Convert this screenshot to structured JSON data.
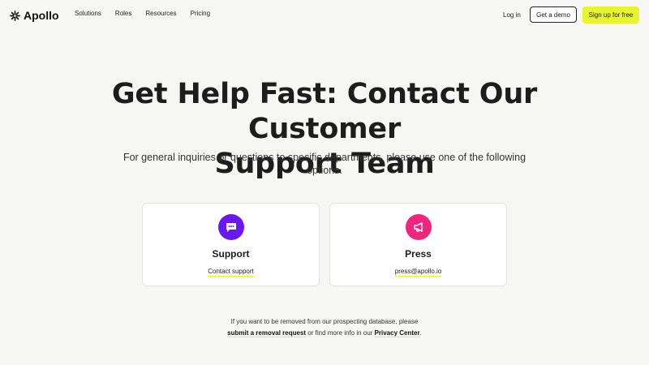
{
  "header": {
    "brand": "Apollo",
    "nav": [
      "Solutions",
      "Roles",
      "Resources",
      "Pricing"
    ],
    "login": "Log in",
    "demo": "Get a demo",
    "signup": "Sign up for free"
  },
  "hero": {
    "title_line1": "Get Help Fast: Contact Our Customer",
    "title_line2": "Support Team",
    "subtitle": "For general inquiries or questions to specific departments, please use one of the following options."
  },
  "cards": [
    {
      "title": "Support",
      "link": "Contact support",
      "icon": "chat-bubble-icon",
      "color": "#6a18f0"
    },
    {
      "title": "Press",
      "link": "press@apollo.io",
      "icon": "megaphone-icon",
      "color": "#f0257e"
    }
  ],
  "note": {
    "text1": "If you want to be removed from our prospecting database, please",
    "link1": "submit a removal request",
    "text2": " or find more info in our ",
    "link2": "Privacy Center",
    "text3": "."
  },
  "colors": {
    "accent_yellow": "#e8f52d",
    "support_purple": "#6a18f0",
    "press_pink": "#f0257e"
  }
}
